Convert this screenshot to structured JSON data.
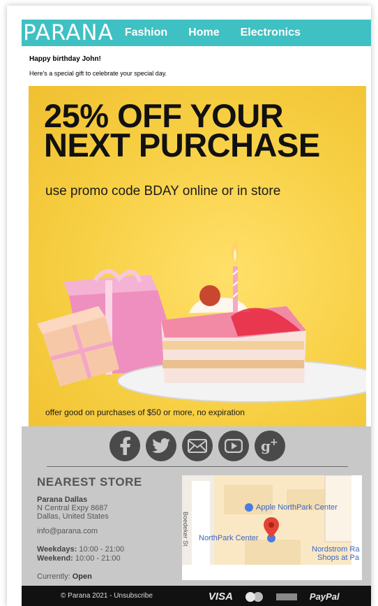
{
  "header": {
    "brand": "PARANA",
    "nav": [
      "Fashion",
      "Home",
      "Electronics"
    ]
  },
  "greeting": "Happy birthday John!",
  "subtext": "Here's a special gift to celebrate your special day.",
  "hero": {
    "title_line1": "25% OFF YOUR",
    "title_line2": "NEXT PURCHASE",
    "promo": "use promo code BDAY online or in store",
    "fine_print": "offer good on purchases of $50 or more, no expiration"
  },
  "social_icons": [
    "facebook-icon",
    "twitter-icon",
    "mail-icon",
    "youtube-icon",
    "google-plus-icon"
  ],
  "store": {
    "heading": "NEAREST STORE",
    "name": "Parana Dallas",
    "address1": "N Central Expy 8687",
    "address2": "Dallas, United States",
    "email": "info@parana.com",
    "weekdays_label": "Weekdays:",
    "weekdays_hours": "10:00 - 21:00",
    "weekend_label": "Weekend:",
    "weekend_hours": "10:00 - 21:00",
    "status_label": "Currently:",
    "status_value": "Open"
  },
  "map": {
    "street": "Boedeker St",
    "place1": "Apple NorthPark Center",
    "place2": "NorthPark Center",
    "place3a": "Nordstrom Ra",
    "place3b": "Shops at Pa"
  },
  "footer": {
    "copyright": "© Parana 2021 - Unsubscribe",
    "visa": "VISA",
    "paypal": "PayPal"
  },
  "colors": {
    "nav_bg": "#3fc0c3",
    "hero_bg": "#f7cf43",
    "footer_gray": "#c8c8c8",
    "bar_bg": "#111111"
  }
}
